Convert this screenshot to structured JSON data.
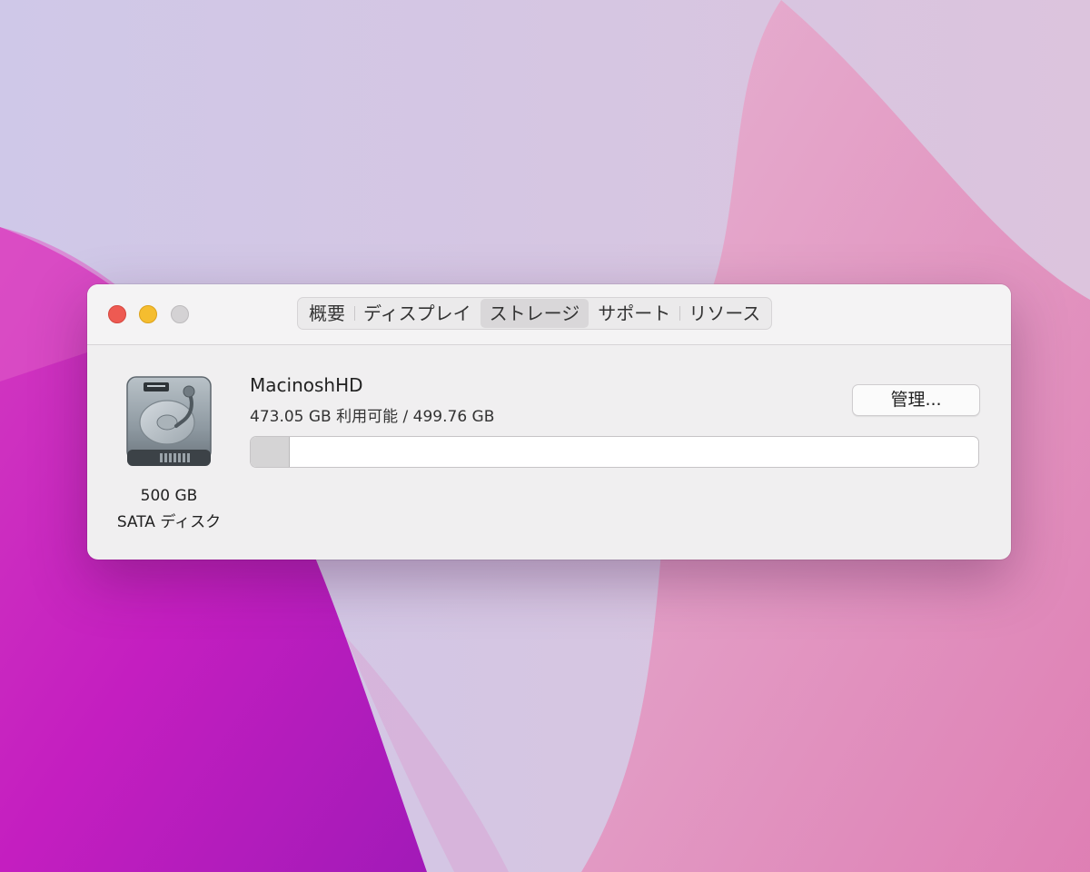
{
  "window": {
    "traffic_lights": [
      {
        "name": "close",
        "color": "#ee5a52"
      },
      {
        "name": "minimize",
        "color": "#f5bd2f"
      },
      {
        "name": "zoom",
        "color": "#d4d2d4"
      }
    ],
    "tabs": [
      {
        "label": "概要",
        "active": false
      },
      {
        "label": "ディスプレイ",
        "active": false
      },
      {
        "label": "ストレージ",
        "active": true
      },
      {
        "label": "サポート",
        "active": false
      },
      {
        "label": "リソース",
        "active": false
      }
    ]
  },
  "storage": {
    "disk": {
      "icon": "hard-disk-icon",
      "size": "500 GB",
      "type": "SATA ディスク"
    },
    "volume_name": "MacinoshHD",
    "usage_text": "473.05 GB 利用可能 / 499.76 GB",
    "manage_button": "管理...",
    "used_fraction": 0.0534
  },
  "colors": {
    "window_bg": "#f0eff0",
    "bar_used": "#d5d4d5",
    "wallpaper_magenta": "#c51fb4",
    "wallpaper_pink": "#e7a6c8"
  }
}
